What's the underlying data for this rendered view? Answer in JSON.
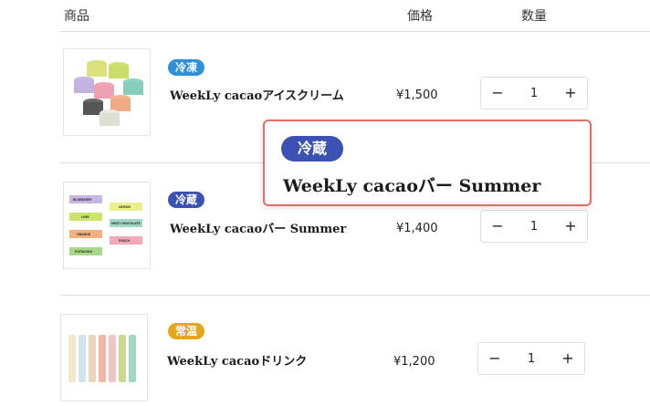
{
  "header": {
    "product": "商品",
    "price": "価格",
    "quantity": "数量"
  },
  "items": [
    {
      "badge": "冷凍",
      "badge_color": "#2f8fd8",
      "name": "WeekLy cacaoアイスクリーム",
      "price": "¥1,500",
      "qty": "1",
      "minus": "−",
      "plus": "+",
      "image": "ice-cream-cups-image"
    },
    {
      "badge": "冷蔵",
      "badge_color": "#3b52b4",
      "name": "WeekLy cacaoバー Summer",
      "price": "¥1,400",
      "qty": "1",
      "minus": "−",
      "plus": "+",
      "image": "chocolate-bars-image",
      "image_labels": [
        "BLUEBERRY",
        "LEMON",
        "LIME",
        "MINT CHOCOLATE",
        "ORANGE",
        "PEACH",
        "PISTACHIO"
      ]
    },
    {
      "badge": "常温",
      "badge_color": "#e5a717",
      "name": "WeekLy cacaoドリンク",
      "price": "¥1,200",
      "qty": "1",
      "minus": "−",
      "plus": "+",
      "image": "drink-bottles-image"
    }
  ],
  "zoom": {
    "badge": "冷蔵",
    "badge_color": "#3b52b4",
    "name": "WeekLy cacaoバー Summer",
    "border_color": "#e36e68"
  }
}
